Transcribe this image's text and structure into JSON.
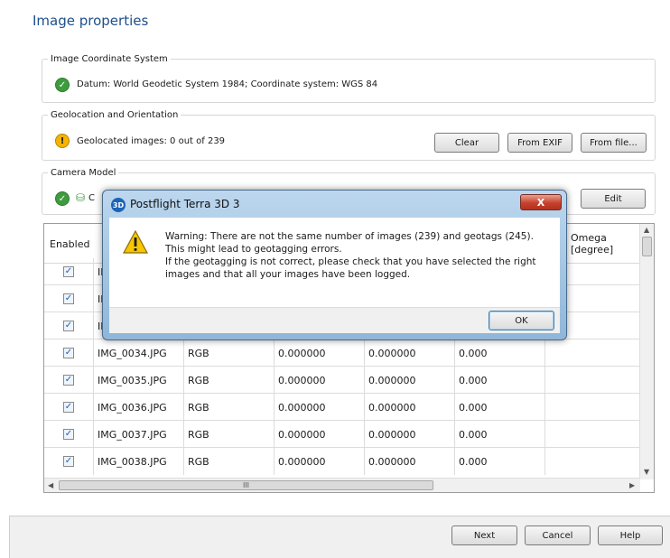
{
  "page": {
    "title": "Image properties"
  },
  "ics": {
    "legend": "Image Coordinate System",
    "status_text": "Datum: World Geodetic System 1984; Coordinate system: WGS 84",
    "status_icon": "check-circle-icon"
  },
  "geo": {
    "legend": "Geolocation and Orientation",
    "status_text": "Geolocated images: 0 out of 239",
    "status_icon": "warning-circle-icon",
    "buttons": {
      "clear": "Clear",
      "from_exif": "From EXIF",
      "from_file": "From file..."
    }
  },
  "camera": {
    "legend": "Camera Model",
    "status_text_partial": "C",
    "status_icon": "check-circle-icon",
    "edit_label": "Edit"
  },
  "table": {
    "columns": {
      "enabled": "Enabled",
      "omega_line1": "Omega",
      "omega_line2": "[degree]"
    },
    "hidden_rows_partial": [
      "IN",
      "IN",
      "IN"
    ],
    "rows": [
      {
        "name": "IMG_0034.JPG",
        "type": "RGB",
        "c3": "0.000000",
        "c4": "0.000000",
        "c5": "0.000"
      },
      {
        "name": "IMG_0035.JPG",
        "type": "RGB",
        "c3": "0.000000",
        "c4": "0.000000",
        "c5": "0.000"
      },
      {
        "name": "IMG_0036.JPG",
        "type": "RGB",
        "c3": "0.000000",
        "c4": "0.000000",
        "c5": "0.000"
      },
      {
        "name": "IMG_0037.JPG",
        "type": "RGB",
        "c3": "0.000000",
        "c4": "0.000000",
        "c5": "0.000"
      },
      {
        "name": "IMG_0038.JPG",
        "type": "RGB",
        "c3": "0.000000",
        "c4": "0.000000",
        "c5": "0.000"
      }
    ],
    "hscroll_grip": "III"
  },
  "footer": {
    "next": "Next",
    "cancel": "Cancel",
    "help": "Help"
  },
  "dialog": {
    "title": "Postflight Terra 3D 3",
    "app_icon_text": "3D",
    "close_label": "X",
    "message_lines": [
      "Warning: There are not the same number of images (239) and geotags (245).",
      "This might lead to geotagging errors.",
      "If the geotagging is not correct, please check that you have selected the right",
      "images and that all your images have been logged."
    ],
    "ok_label": "OK"
  },
  "colors": {
    "title": "#1f4e8c",
    "ok": "#3f9b3f",
    "warning": "#f5b400",
    "close": "#c7412c"
  }
}
